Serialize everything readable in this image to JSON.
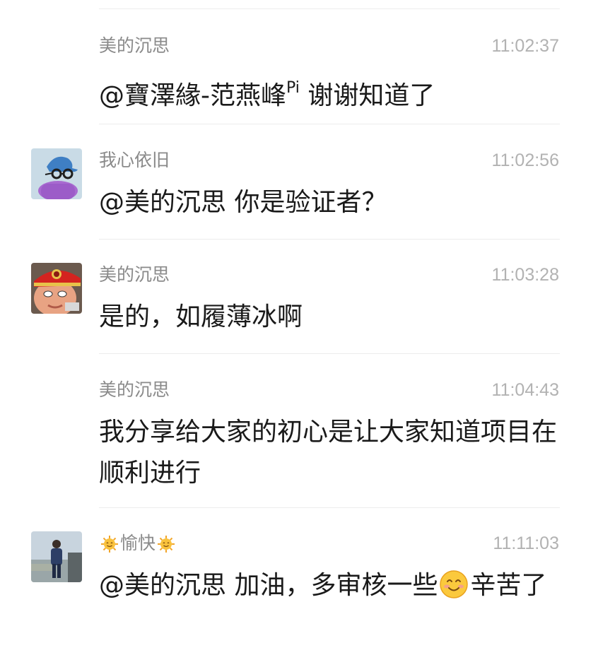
{
  "messages": [
    {
      "sender": "美的沉思",
      "time": "11:02:37",
      "text_prefix": "@寶澤緣-范燕峰",
      "text_sup": "Pi",
      "text_suffix": " 谢谢知道了",
      "has_avatar": false
    },
    {
      "sender": "我心依旧",
      "time": "11:02:56",
      "text": "@美的沉思 你是验证者？",
      "has_avatar": true,
      "avatar": "blue-cap-glasses-avatar"
    },
    {
      "sender": "美的沉思",
      "time": "11:03:28",
      "text": "是的，如履薄冰啊",
      "has_avatar": true,
      "avatar": "red-hat-character-avatar"
    },
    {
      "sender": "美的沉思",
      "time": "11:04:43",
      "text": "我分享给大家的初心是让大家知道项目在顺利进行",
      "has_avatar": false
    },
    {
      "sender_emoji": "sun-face",
      "sender": "愉快",
      "time": "11:11:03",
      "text_before_emoji": "@美的沉思 加油，多审核一些",
      "text_emoji": "smiling-face",
      "text_after_emoji": "辛苦了",
      "has_avatar": true,
      "avatar": "man-standing-photo-avatar"
    }
  ],
  "colors": {
    "name": "#8a8a8a",
    "time": "#b2b2b2",
    "text": "#1a1a1a",
    "divider": "#ececec"
  }
}
